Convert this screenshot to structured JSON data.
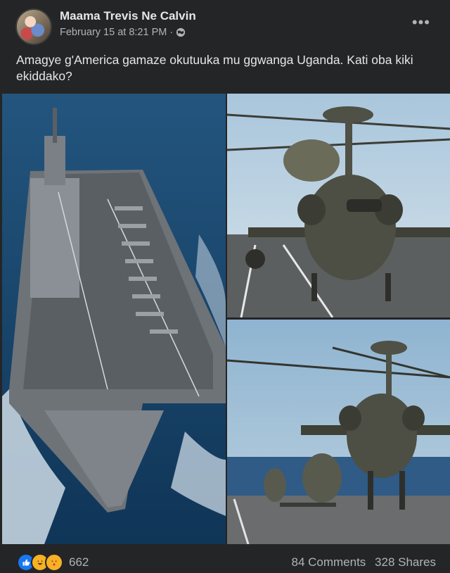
{
  "post": {
    "author": "Maama Trevis Ne Calvin",
    "timestamp": "February 15 at 8:21 PM",
    "separator": "·",
    "audience_icon": "globe-icon",
    "more_label": "•••",
    "caption": "Amagye g'America gamaze okutuuka mu ggwanga Uganda. Kati oba kiki ekiddako?"
  },
  "photos": [
    {
      "subject": "aircraft-carrier-icon"
    },
    {
      "subject": "attack-helicopter-icon"
    },
    {
      "subject": "helicopters-on-deck-icon"
    }
  ],
  "footer": {
    "reaction_icons": [
      "like-icon",
      "haha-icon",
      "care-icon"
    ],
    "reaction_count": "662",
    "comments": "84 Comments",
    "shares": "328 Shares"
  },
  "colors": {
    "background": "#242526",
    "text_primary": "#e4e6eb",
    "text_secondary": "#b0b3b8",
    "like_blue": "#1877f2",
    "reaction_yellow": "#f7b125"
  }
}
